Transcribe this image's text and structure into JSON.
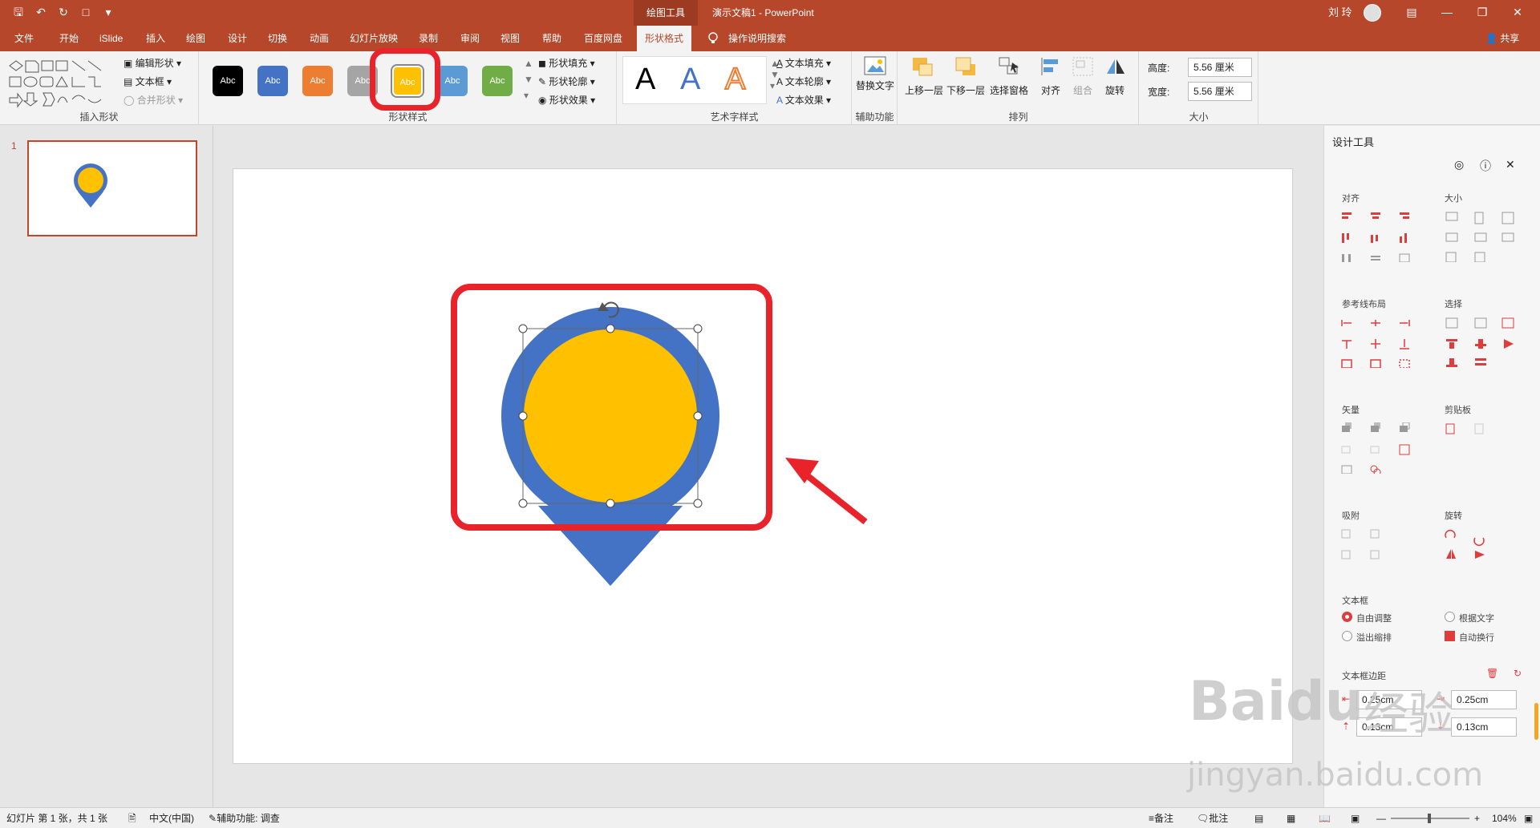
{
  "titlebar": {
    "tool_tab": "绘图工具",
    "document_title": "演示文稿1  -  PowerPoint",
    "user_name": "刘 玲"
  },
  "tabs": [
    {
      "label": "文件"
    },
    {
      "label": "开始"
    },
    {
      "label": "iSlide"
    },
    {
      "label": "插入"
    },
    {
      "label": "绘图"
    },
    {
      "label": "设计"
    },
    {
      "label": "切换"
    },
    {
      "label": "动画"
    },
    {
      "label": "幻灯片放映"
    },
    {
      "label": "录制"
    },
    {
      "label": "审阅"
    },
    {
      "label": "视图"
    },
    {
      "label": "帮助"
    },
    {
      "label": "百度网盘"
    },
    {
      "label": "形状格式"
    }
  ],
  "search": {
    "label": "操作说明搜索"
  },
  "share_label": "共享",
  "ribbon": {
    "insert_shapes": {
      "edit_shape": "编辑形状",
      "text_box": "文本框",
      "merge_shapes": "合并形状",
      "label": "插入形状"
    },
    "shape_styles": {
      "swatch_text": "Abc",
      "fill": "形状填充",
      "outline": "形状轮廓",
      "effects": "形状效果",
      "label": "形状样式",
      "swatches": [
        "#000000",
        "#4472c4",
        "#ed7d31",
        "#a5a5a5",
        "#ffc000",
        "#5b9bd5",
        "#70ad47"
      ]
    },
    "wordart": {
      "letter": "A",
      "text_fill": "文本填充",
      "text_outline": "文本轮廓",
      "text_effects": "文本效果",
      "label": "艺术字样式"
    },
    "accessibility": {
      "alt_text": "替换文字",
      "label": "辅助功能"
    },
    "arrange": {
      "bring_forward": "上移一层",
      "send_backward": "下移一层",
      "selection_pane": "选择窗格",
      "align": "对齐",
      "group": "组合",
      "rotate": "旋转",
      "label": "排列"
    },
    "size": {
      "height_label": "高度:",
      "height_value": "5.56 厘米",
      "width_label": "宽度:",
      "width_value": "5.56 厘米",
      "label": "大小"
    }
  },
  "thumbnails": {
    "slide_number": "1"
  },
  "pane": {
    "title": "设计工具",
    "align": "对齐",
    "size": "大小",
    "guide_layout": "参考线布局",
    "select": "选择",
    "vector": "矢量",
    "clipboard": "剪贴板",
    "snap": "吸附",
    "rotate": "旋转",
    "textbox": "文本框",
    "auto_fit": "自由调整",
    "fit_text": "根据文字",
    "overflow": "溢出缩排",
    "wrap": "自动换行",
    "margins": "文本框边距",
    "margin_left": "0.25cm",
    "margin_right": "0.25cm",
    "margin_top": "0.13cm",
    "margin_bottom": "0.13cm"
  },
  "status": {
    "slide_info": "幻灯片 第 1 张，共 1 张",
    "language": "中文(中国)",
    "accessibility": "辅助功能: 调查",
    "notes": "备注",
    "comments": "批注",
    "zoom": "104%"
  },
  "watermark": {
    "brand": "Baidu",
    "cn": "经验",
    "url": "jingyan.baidu.com"
  },
  "colors": {
    "accent": "#b7472a",
    "blue": "#4472c4",
    "yellow": "#ffc000",
    "highlight": "#e8232a"
  }
}
